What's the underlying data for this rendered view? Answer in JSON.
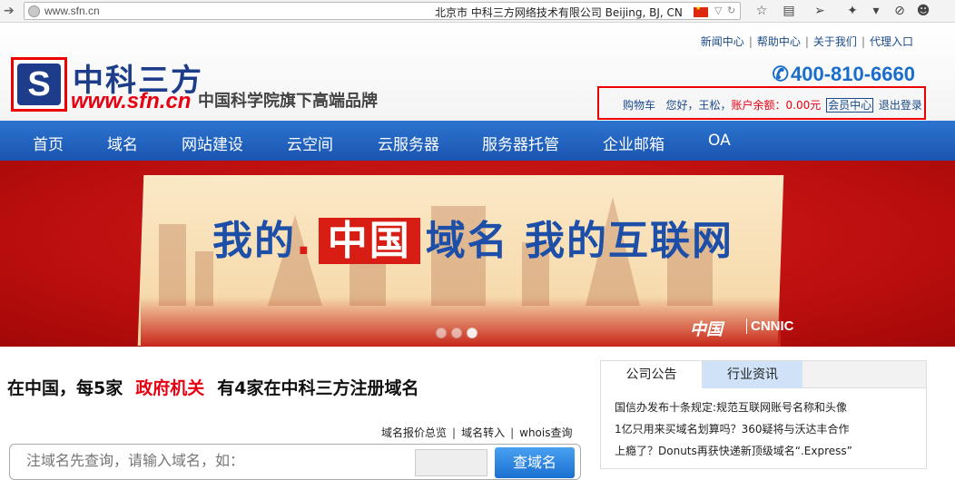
{
  "browser": {
    "url": "www.sfn.cn",
    "geo": "北京市 中科三方网络技术有限公司   Beijing, BJ, CN"
  },
  "header": {
    "toplinks": [
      "新闻中心",
      "帮助中心",
      "关于我们",
      "代理入口"
    ],
    "logo_letter": "S",
    "brand_cn": "中科三方",
    "brand_url": "www.sfn.cn",
    "brand_sub": "中国科学院旗下高端品牌",
    "phone": "400-810-6660",
    "account": {
      "cart": "购物车",
      "greeting": "您好，王松，",
      "balance_label": "账户余额：",
      "balance": "0.00元",
      "member": "会员中心",
      "logout": "退出登录"
    }
  },
  "nav": [
    "首页",
    "域名",
    "网站建设",
    "云空间",
    "云服务器",
    "服务器托管",
    "企业邮箱",
    "OA"
  ],
  "banner": {
    "slogan_pre": "我的",
    "slogan_dot": ".",
    "slogan_zg": "中国",
    "slogan_post": "域名  我的互联网",
    "logo_cn": "中国",
    "logo_cnnic": "CNNIC",
    "slides": 3,
    "active_slide": 3
  },
  "main": {
    "tagline_pre": "在中国，每5家",
    "tagline_gov": "政府机关",
    "tagline_post": "有4家在中科三方注册域名",
    "links": [
      "域名报价总览",
      "域名转入",
      "whois查询"
    ],
    "search_placeholder": "注域名先查询，请输入域名，如：",
    "search_button": "查域名"
  },
  "news": {
    "tabs": [
      "公司公告",
      "行业资讯"
    ],
    "items": [
      "国信办发布十条规定:规范互联网账号名称和头像",
      "1亿只用来买域名划算吗？360疑将与沃达丰合作",
      "上瘾了？Donuts再获快递新顶级域名“.Express”"
    ]
  }
}
